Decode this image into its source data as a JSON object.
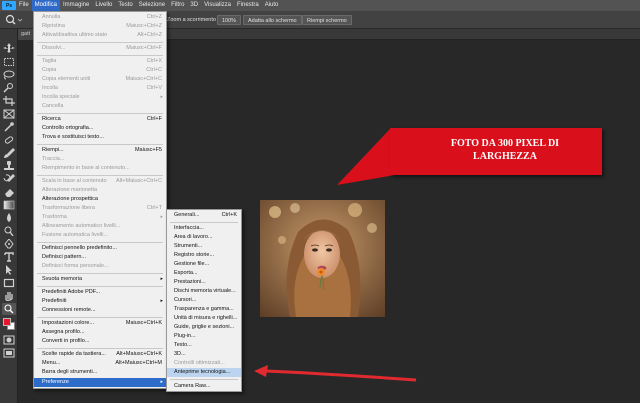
{
  "menubar": {
    "logo": "Ps",
    "items": [
      "File",
      "Modifica",
      "Immagine",
      "Livello",
      "Testo",
      "Selezione",
      "Filtro",
      "3D",
      "Visualizza",
      "Finestra",
      "Aiuto"
    ]
  },
  "options": {
    "scroll_label": "Zoom a scorrimento",
    "zoom": "100%",
    "fit_button": "Adatta allo schermo",
    "fill_button": "Riempi schermo"
  },
  "document_tab": "gatt",
  "callout": {
    "line1": "FOTO DA 300 PIXEL DI",
    "line2": "LARGHEZZA"
  },
  "edit_menu": {
    "items": [
      {
        "label": "Annulla",
        "shortcut": "Ctrl+Z",
        "disabled": true
      },
      {
        "label": "Ripristina",
        "shortcut": "Maiusc+Ctrl+Z",
        "disabled": true
      },
      {
        "label": "Attiva/disattiva ultimo stato",
        "shortcut": "Alt+Ctrl+Z",
        "disabled": true
      },
      {
        "label": "Dissolvi...",
        "shortcut": "Maiusc+Ctrl+F",
        "disabled": true
      },
      {
        "label": "Taglia",
        "shortcut": "Ctrl+X",
        "disabled": true
      },
      {
        "label": "Copia",
        "shortcut": "Ctrl+C",
        "disabled": true
      },
      {
        "label": "Copia elementi uniti",
        "shortcut": "Maiusc+Ctrl+C",
        "disabled": true
      },
      {
        "label": "Incolla",
        "shortcut": "Ctrl+V",
        "disabled": true
      },
      {
        "label": "Incolla speciale",
        "shortcut": "",
        "disabled": true
      },
      {
        "label": "Cancella",
        "shortcut": "",
        "disabled": true
      },
      {
        "label": "Ricerca",
        "shortcut": "Ctrl+F",
        "disabled": false
      },
      {
        "label": "Controllo ortografia...",
        "shortcut": "",
        "disabled": false
      },
      {
        "label": "Trova e sostituisci testo...",
        "shortcut": "",
        "disabled": false
      },
      {
        "label": "Riempi...",
        "shortcut": "Maiusc+F5",
        "disabled": false
      },
      {
        "label": "Traccia...",
        "shortcut": "",
        "disabled": true
      },
      {
        "label": "Riempimento in base al contenuto...",
        "shortcut": "",
        "disabled": true
      },
      {
        "label": "Scala in base al contenuto",
        "shortcut": "Alt+Maiusc+Ctrl+C",
        "disabled": true
      },
      {
        "label": "Alterazione marionetta",
        "shortcut": "",
        "disabled": true
      },
      {
        "label": "Alterazione prospettica",
        "shortcut": "",
        "disabled": false
      },
      {
        "label": "Trasformazione libera",
        "shortcut": "Ctrl+T",
        "disabled": true
      },
      {
        "label": "Trasforma",
        "shortcut": "",
        "disabled": true
      },
      {
        "label": "Allineamento automatico livelli...",
        "shortcut": "",
        "disabled": true
      },
      {
        "label": "Fusione automatica livelli...",
        "shortcut": "",
        "disabled": true
      },
      {
        "label": "Definisci pennello predefinito...",
        "shortcut": "",
        "disabled": false
      },
      {
        "label": "Definisci pattern...",
        "shortcut": "",
        "disabled": false
      },
      {
        "label": "Definisci forma personale...",
        "shortcut": "",
        "disabled": true
      },
      {
        "label": "Svuota memoria",
        "shortcut": "",
        "disabled": false
      },
      {
        "label": "Predefiniti Adobe PDF...",
        "shortcut": "",
        "disabled": false
      },
      {
        "label": "Predefiniti",
        "shortcut": "",
        "disabled": false
      },
      {
        "label": "Connessioni remote...",
        "shortcut": "",
        "disabled": false
      },
      {
        "label": "Impostazioni colore...",
        "shortcut": "Maiusc+Ctrl+K",
        "disabled": false
      },
      {
        "label": "Assegna profilo...",
        "shortcut": "",
        "disabled": false
      },
      {
        "label": "Converti in profilo...",
        "shortcut": "",
        "disabled": false
      },
      {
        "label": "Scelte rapide da tastiera...",
        "shortcut": "Alt+Maiusc+Ctrl+K",
        "disabled": false
      },
      {
        "label": "Menu...",
        "shortcut": "Alt+Maiusc+Ctrl+M",
        "disabled": false
      },
      {
        "label": "Barra degli strumenti...",
        "shortcut": "",
        "disabled": false
      },
      {
        "label": "Preferenze",
        "shortcut": "",
        "disabled": false
      }
    ]
  },
  "pref_menu": {
    "items": [
      {
        "label": "Generali...",
        "shortcut": "Ctrl+K",
        "disabled": false
      },
      {
        "label": "Interfaccia...",
        "shortcut": "",
        "disabled": false
      },
      {
        "label": "Area di lavoro...",
        "shortcut": "",
        "disabled": false
      },
      {
        "label": "Strumenti...",
        "shortcut": "",
        "disabled": false
      },
      {
        "label": "Registro storie...",
        "shortcut": "",
        "disabled": false
      },
      {
        "label": "Gestione file...",
        "shortcut": "",
        "disabled": false
      },
      {
        "label": "Esporta...",
        "shortcut": "",
        "disabled": false
      },
      {
        "label": "Prestazioni...",
        "shortcut": "",
        "disabled": false
      },
      {
        "label": "Dischi memoria virtuale...",
        "shortcut": "",
        "disabled": false
      },
      {
        "label": "Cursori...",
        "shortcut": "",
        "disabled": false
      },
      {
        "label": "Trasparenza e gamma...",
        "shortcut": "",
        "disabled": false
      },
      {
        "label": "Unità di misura e righelli...",
        "shortcut": "",
        "disabled": false
      },
      {
        "label": "Guide, griglie e sezioni...",
        "shortcut": "",
        "disabled": false
      },
      {
        "label": "Plug-in...",
        "shortcut": "",
        "disabled": false
      },
      {
        "label": "Testo...",
        "shortcut": "",
        "disabled": false
      },
      {
        "label": "3D...",
        "shortcut": "",
        "disabled": false
      },
      {
        "label": "Controlli ottimizzati...",
        "shortcut": "",
        "disabled": true
      },
      {
        "label": "Anteprime tecnologia...",
        "shortcut": "",
        "disabled": false
      },
      {
        "label": "Camera Raw...",
        "shortcut": "",
        "disabled": false
      }
    ]
  },
  "colors": {
    "accent": "#2d6dc9",
    "callout": "#d9101b",
    "arrow": "#e02a2f",
    "foreground_swatch": "#e8142c"
  }
}
